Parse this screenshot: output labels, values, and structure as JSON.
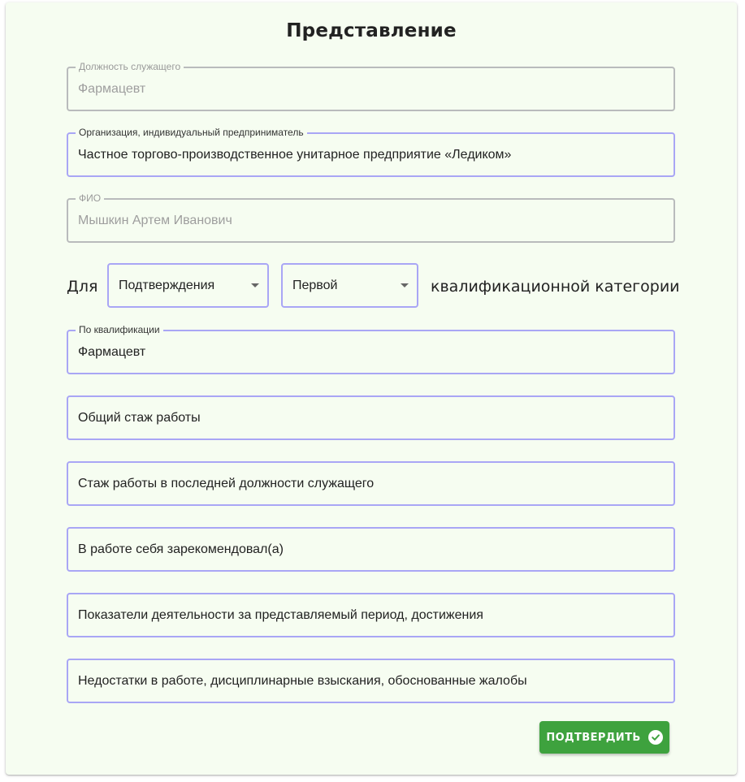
{
  "form": {
    "title": "Представление",
    "position": {
      "label": "Должность служащего",
      "value": "Фармацевт"
    },
    "organization": {
      "label": "Организация, индивидуальный предприниматель",
      "value": "Частное торгово-производственное унитарное предприятие «Ледиком»"
    },
    "fio": {
      "label": "ФИО",
      "value": "Мышкин Артем Иванович"
    },
    "purpose_row": {
      "prefix": "Для",
      "purpose_select": "Подтверждения",
      "category_select": "Первой",
      "suffix": "квалификационной категории"
    },
    "qualification": {
      "label": "По квалификации",
      "value": "Фармацевт"
    },
    "total_experience": {
      "placeholder": "Общий стаж работы"
    },
    "last_position_experience": {
      "placeholder": "Стаж работы в последней должности служащего"
    },
    "recommended": {
      "placeholder": "В работе себя зарекомендовал(а)"
    },
    "achievements": {
      "placeholder": "Показатели деятельности за представляемый период, достижения"
    },
    "shortcomings": {
      "placeholder": "Недостатки в работе, дисциплинарные взыскания, обоснованные жалобы"
    },
    "submit_label": "ПОДТВЕРДИТЬ",
    "submit_icon": "check-circle-icon"
  },
  "colors": {
    "background": "#f6fdf1",
    "field_border": "#a9a6f5",
    "disabled_border": "#b9bbbc",
    "button": "#3ea23e"
  }
}
